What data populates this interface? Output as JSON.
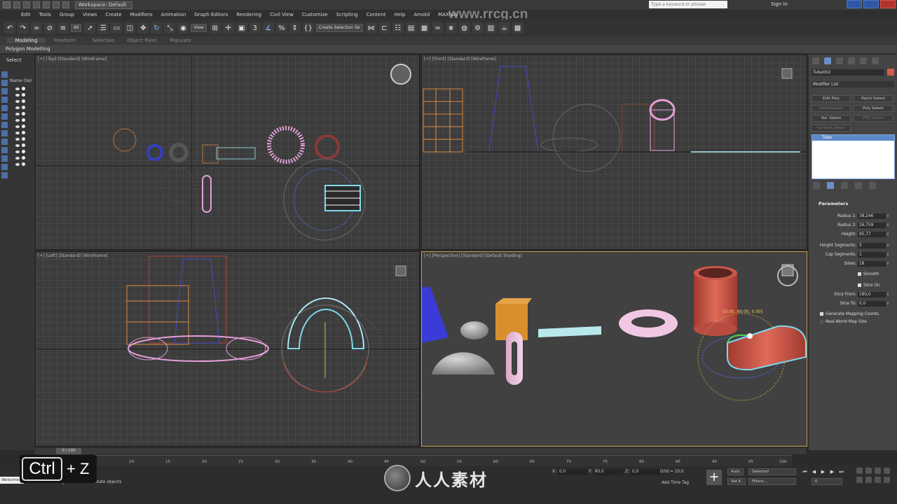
{
  "titlebar": {
    "workspace": "Workspace: Default",
    "search_placeholder": "Type a keyword or phrase",
    "signin": "Sign In"
  },
  "menu": [
    "Edit",
    "Tools",
    "Group",
    "Views",
    "Create",
    "Modifiers",
    "Animation",
    "Graph Editors",
    "Rendering",
    "Civil View",
    "Customize",
    "Scripting",
    "Content",
    "Help",
    "Arnold",
    "MAXtoA"
  ],
  "toolbar": {
    "filter": "All",
    "view": "View",
    "selection_set": "Create Selection Se"
  },
  "ribbon": {
    "tabs": [
      "Modeling",
      "Freeform",
      "Selection",
      "Object Paint",
      "Populate"
    ],
    "active": "Modeling",
    "sub": "Polygon Modelling"
  },
  "explorer": {
    "title": "Select",
    "name_header": "Name (Sor"
  },
  "viewports": {
    "top": "[+] [Top] [Standard] [Wireframe]",
    "front": "[+] [Front] [Standard] [Wireframe]",
    "left": "[+] [Left] [Standard] [Wireframe]",
    "perspective": "[+] [Perspective] [Standard] [Default Shading]",
    "gizmo_readout": "[0.00, 80.00, 0.00]"
  },
  "command_panel": {
    "object_name": "Tube002",
    "object_color": "#d9594c",
    "modifier_list": "Modifier List",
    "modifier_buttons": [
      {
        "label": "Edit Poly",
        "enabled": true
      },
      {
        "label": "Patch Select",
        "enabled": true
      },
      {
        "label": "SplineSelect",
        "enabled": false
      },
      {
        "label": "Poly Select",
        "enabled": true
      },
      {
        "label": "Vol. Select",
        "enabled": true
      },
      {
        "label": "FFD Select",
        "enabled": false
      },
      {
        "label": "Surface Select",
        "enabled": false
      }
    ],
    "stack_item": "Tube",
    "parameters_title": "Parameters",
    "params": [
      {
        "label": "Radius 1:",
        "value": "38,246"
      },
      {
        "label": "Radius 2:",
        "value": "26,759"
      },
      {
        "label": "Height:",
        "value": "95,77"
      },
      {
        "label": "Height Segments:",
        "value": "5"
      },
      {
        "label": "Cap Segments:",
        "value": "1"
      },
      {
        "label": "Sides:",
        "value": "18"
      },
      {
        "label": "Slice From:",
        "value": "180,0"
      },
      {
        "label": "Slice To:",
        "value": "0,0"
      }
    ],
    "smooth": "Smooth",
    "slice_on": "Slice On",
    "gen_mapping": "Generate Mapping Coords.",
    "real_world": "Real-World Map Size"
  },
  "timeline": {
    "slider": "0 / 100",
    "ticks": [
      "10",
      "15",
      "20",
      "25",
      "30",
      "35",
      "40",
      "45",
      "50",
      "55",
      "60",
      "65",
      "70",
      "75",
      "80",
      "85",
      "90",
      "95",
      "100"
    ]
  },
  "status": {
    "welcome": "Welcome",
    "prompt": "Click and drag to select and rotate objects",
    "x": "0,0",
    "y": "80,0",
    "z": "0,0",
    "grid": "Grid = 10,0",
    "add_time_tag": "Add Time Tag",
    "auto": "Auto",
    "selected": "Selected",
    "set_k": "Set K.",
    "filters": "Filters...",
    "frame": "0"
  },
  "overlay": {
    "ctrl": "Ctrl",
    "plus_key": "+ Z",
    "watermark_top": "www.rrcg.cn",
    "brand": "人人素材"
  }
}
